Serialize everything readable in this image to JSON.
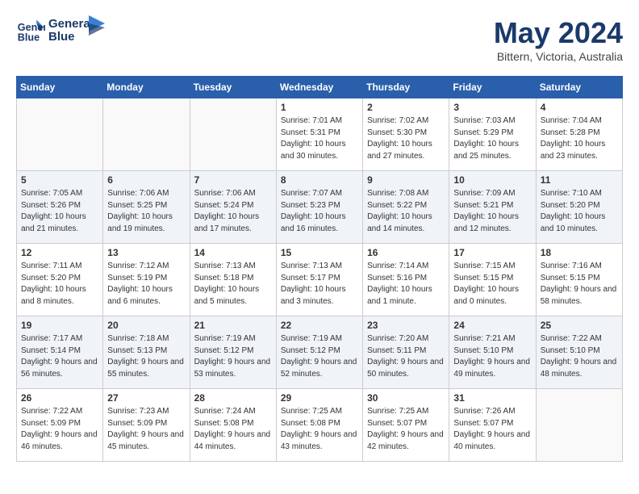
{
  "header": {
    "logo_line1": "General",
    "logo_line2": "Blue",
    "month_title": "May 2024",
    "location": "Bittern, Victoria, Australia"
  },
  "weekdays": [
    "Sunday",
    "Monday",
    "Tuesday",
    "Wednesday",
    "Thursday",
    "Friday",
    "Saturday"
  ],
  "weeks": [
    [
      {
        "day": "",
        "sunrise": "",
        "sunset": "",
        "daylight": ""
      },
      {
        "day": "",
        "sunrise": "",
        "sunset": "",
        "daylight": ""
      },
      {
        "day": "",
        "sunrise": "",
        "sunset": "",
        "daylight": ""
      },
      {
        "day": "1",
        "sunrise": "Sunrise: 7:01 AM",
        "sunset": "Sunset: 5:31 PM",
        "daylight": "Daylight: 10 hours and 30 minutes."
      },
      {
        "day": "2",
        "sunrise": "Sunrise: 7:02 AM",
        "sunset": "Sunset: 5:30 PM",
        "daylight": "Daylight: 10 hours and 27 minutes."
      },
      {
        "day": "3",
        "sunrise": "Sunrise: 7:03 AM",
        "sunset": "Sunset: 5:29 PM",
        "daylight": "Daylight: 10 hours and 25 minutes."
      },
      {
        "day": "4",
        "sunrise": "Sunrise: 7:04 AM",
        "sunset": "Sunset: 5:28 PM",
        "daylight": "Daylight: 10 hours and 23 minutes."
      }
    ],
    [
      {
        "day": "5",
        "sunrise": "Sunrise: 7:05 AM",
        "sunset": "Sunset: 5:26 PM",
        "daylight": "Daylight: 10 hours and 21 minutes."
      },
      {
        "day": "6",
        "sunrise": "Sunrise: 7:06 AM",
        "sunset": "Sunset: 5:25 PM",
        "daylight": "Daylight: 10 hours and 19 minutes."
      },
      {
        "day": "7",
        "sunrise": "Sunrise: 7:06 AM",
        "sunset": "Sunset: 5:24 PM",
        "daylight": "Daylight: 10 hours and 17 minutes."
      },
      {
        "day": "8",
        "sunrise": "Sunrise: 7:07 AM",
        "sunset": "Sunset: 5:23 PM",
        "daylight": "Daylight: 10 hours and 16 minutes."
      },
      {
        "day": "9",
        "sunrise": "Sunrise: 7:08 AM",
        "sunset": "Sunset: 5:22 PM",
        "daylight": "Daylight: 10 hours and 14 minutes."
      },
      {
        "day": "10",
        "sunrise": "Sunrise: 7:09 AM",
        "sunset": "Sunset: 5:21 PM",
        "daylight": "Daylight: 10 hours and 12 minutes."
      },
      {
        "day": "11",
        "sunrise": "Sunrise: 7:10 AM",
        "sunset": "Sunset: 5:20 PM",
        "daylight": "Daylight: 10 hours and 10 minutes."
      }
    ],
    [
      {
        "day": "12",
        "sunrise": "Sunrise: 7:11 AM",
        "sunset": "Sunset: 5:20 PM",
        "daylight": "Daylight: 10 hours and 8 minutes."
      },
      {
        "day": "13",
        "sunrise": "Sunrise: 7:12 AM",
        "sunset": "Sunset: 5:19 PM",
        "daylight": "Daylight: 10 hours and 6 minutes."
      },
      {
        "day": "14",
        "sunrise": "Sunrise: 7:13 AM",
        "sunset": "Sunset: 5:18 PM",
        "daylight": "Daylight: 10 hours and 5 minutes."
      },
      {
        "day": "15",
        "sunrise": "Sunrise: 7:13 AM",
        "sunset": "Sunset: 5:17 PM",
        "daylight": "Daylight: 10 hours and 3 minutes."
      },
      {
        "day": "16",
        "sunrise": "Sunrise: 7:14 AM",
        "sunset": "Sunset: 5:16 PM",
        "daylight": "Daylight: 10 hours and 1 minute."
      },
      {
        "day": "17",
        "sunrise": "Sunrise: 7:15 AM",
        "sunset": "Sunset: 5:15 PM",
        "daylight": "Daylight: 10 hours and 0 minutes."
      },
      {
        "day": "18",
        "sunrise": "Sunrise: 7:16 AM",
        "sunset": "Sunset: 5:15 PM",
        "daylight": "Daylight: 9 hours and 58 minutes."
      }
    ],
    [
      {
        "day": "19",
        "sunrise": "Sunrise: 7:17 AM",
        "sunset": "Sunset: 5:14 PM",
        "daylight": "Daylight: 9 hours and 56 minutes."
      },
      {
        "day": "20",
        "sunrise": "Sunrise: 7:18 AM",
        "sunset": "Sunset: 5:13 PM",
        "daylight": "Daylight: 9 hours and 55 minutes."
      },
      {
        "day": "21",
        "sunrise": "Sunrise: 7:19 AM",
        "sunset": "Sunset: 5:12 PM",
        "daylight": "Daylight: 9 hours and 53 minutes."
      },
      {
        "day": "22",
        "sunrise": "Sunrise: 7:19 AM",
        "sunset": "Sunset: 5:12 PM",
        "daylight": "Daylight: 9 hours and 52 minutes."
      },
      {
        "day": "23",
        "sunrise": "Sunrise: 7:20 AM",
        "sunset": "Sunset: 5:11 PM",
        "daylight": "Daylight: 9 hours and 50 minutes."
      },
      {
        "day": "24",
        "sunrise": "Sunrise: 7:21 AM",
        "sunset": "Sunset: 5:10 PM",
        "daylight": "Daylight: 9 hours and 49 minutes."
      },
      {
        "day": "25",
        "sunrise": "Sunrise: 7:22 AM",
        "sunset": "Sunset: 5:10 PM",
        "daylight": "Daylight: 9 hours and 48 minutes."
      }
    ],
    [
      {
        "day": "26",
        "sunrise": "Sunrise: 7:22 AM",
        "sunset": "Sunset: 5:09 PM",
        "daylight": "Daylight: 9 hours and 46 minutes."
      },
      {
        "day": "27",
        "sunrise": "Sunrise: 7:23 AM",
        "sunset": "Sunset: 5:09 PM",
        "daylight": "Daylight: 9 hours and 45 minutes."
      },
      {
        "day": "28",
        "sunrise": "Sunrise: 7:24 AM",
        "sunset": "Sunset: 5:08 PM",
        "daylight": "Daylight: 9 hours and 44 minutes."
      },
      {
        "day": "29",
        "sunrise": "Sunrise: 7:25 AM",
        "sunset": "Sunset: 5:08 PM",
        "daylight": "Daylight: 9 hours and 43 minutes."
      },
      {
        "day": "30",
        "sunrise": "Sunrise: 7:25 AM",
        "sunset": "Sunset: 5:07 PM",
        "daylight": "Daylight: 9 hours and 42 minutes."
      },
      {
        "day": "31",
        "sunrise": "Sunrise: 7:26 AM",
        "sunset": "Sunset: 5:07 PM",
        "daylight": "Daylight: 9 hours and 40 minutes."
      },
      {
        "day": "",
        "sunrise": "",
        "sunset": "",
        "daylight": ""
      }
    ]
  ]
}
